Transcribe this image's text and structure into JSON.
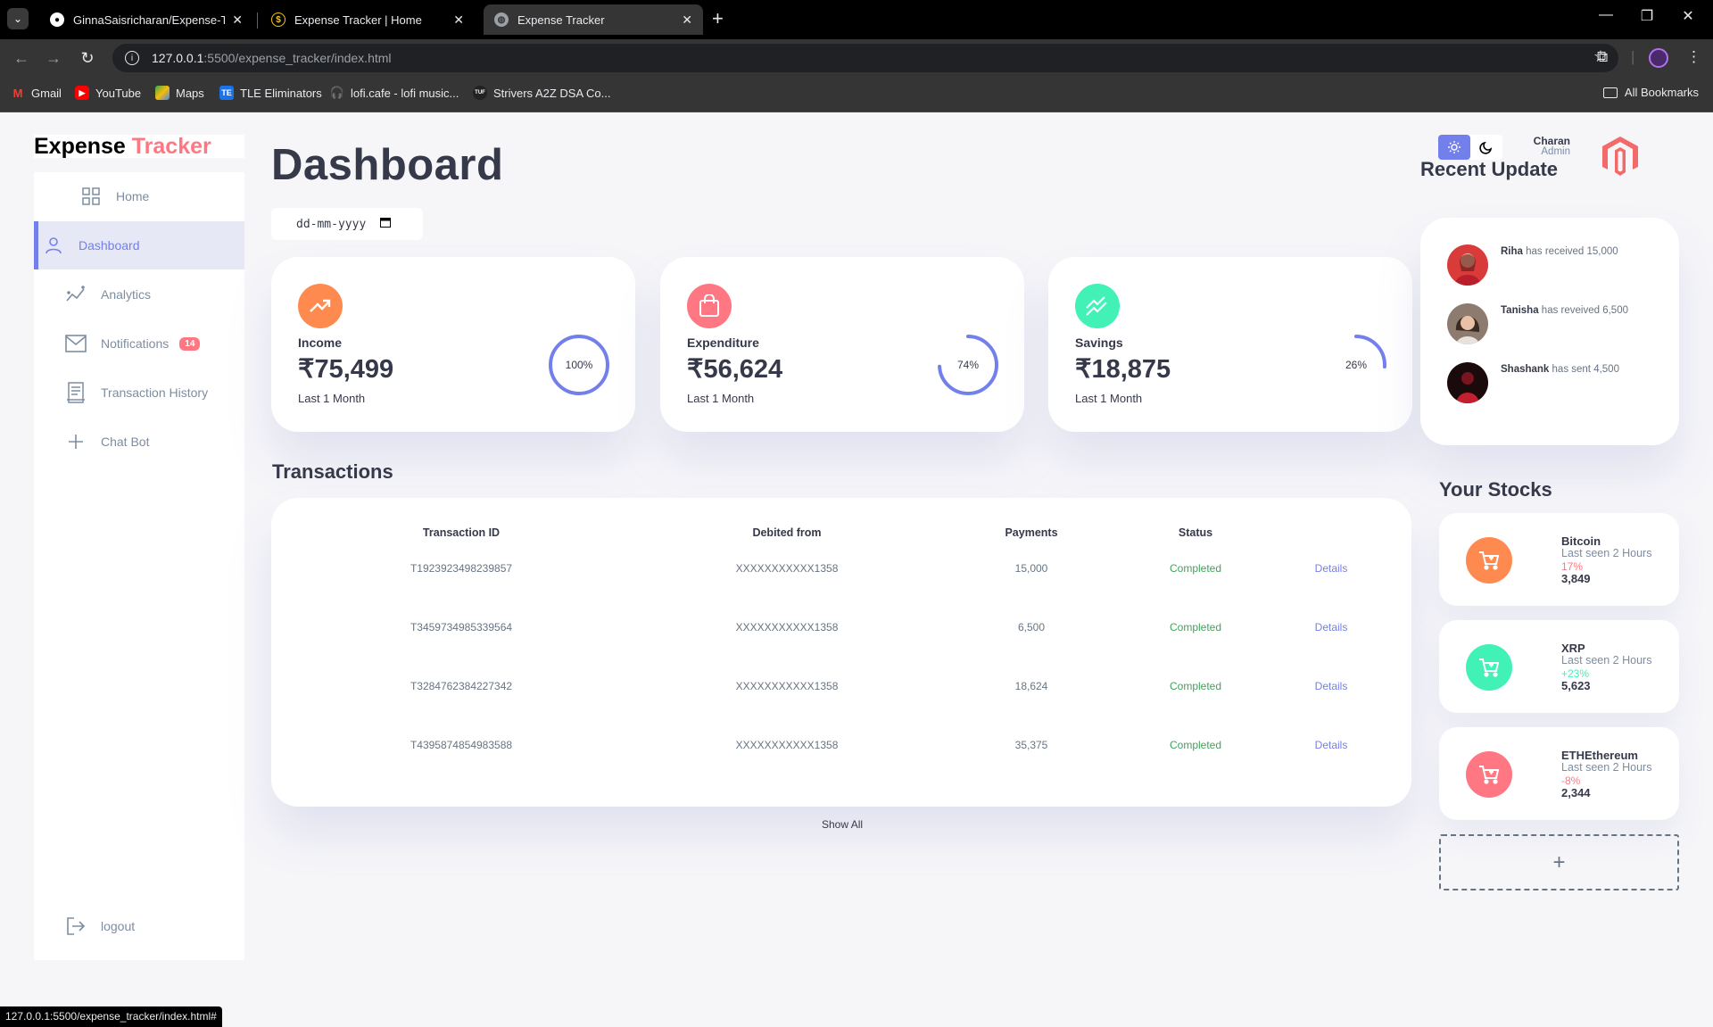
{
  "browser": {
    "tabs": [
      {
        "title": "GinnaSaisricharan/Expense-Trac",
        "icon": "github-icon"
      },
      {
        "title": "Expense Tracker | Home",
        "icon": "coin-icon"
      },
      {
        "title": "Expense Tracker",
        "icon": "globe-icon"
      }
    ],
    "url_host": "127.0.0.1",
    "url_path": ":5500/expense_tracker/index.html",
    "bookmarks": [
      "Gmail",
      "YouTube",
      "Maps",
      "TLE Eliminators",
      "lofi.cafe - lofi music...",
      "Strivers A2Z DSA Co..."
    ],
    "all_bookmarks": "All Bookmarks",
    "status_url": "127.0.0.1:5500/expense_tracker/index.html#"
  },
  "app": {
    "logo_main": "Expense ",
    "logo_accent": "Tracker",
    "sidebar": [
      {
        "label": "Home",
        "icon": "grid-icon"
      },
      {
        "label": "Dashboard",
        "icon": "person-icon",
        "active": true
      },
      {
        "label": "Analytics",
        "icon": "insights-icon"
      },
      {
        "label": "Notifications",
        "icon": "mail-icon",
        "badge": "14"
      },
      {
        "label": "Transaction History",
        "icon": "receipt-icon"
      },
      {
        "label": "Chat Bot",
        "icon": "plus-icon"
      }
    ],
    "logout": "logout",
    "title": "Dashboard",
    "date_placeholder": "dd-mm-yyyy",
    "cards": [
      {
        "label": "Income",
        "amount": "₹75,499",
        "sub": "Last 1 Month",
        "percent": "100%",
        "fraction": 1.0,
        "color": "#ff8a50"
      },
      {
        "label": "Expenditure",
        "amount": "₹56,624",
        "sub": "Last 1 Month",
        "percent": "74%",
        "fraction": 0.74,
        "color": "#ff7782"
      },
      {
        "label": "Savings",
        "amount": "₹18,875",
        "sub": "Last 1 Month",
        "percent": "26%",
        "fraction": 0.26,
        "color": "#41f1b6"
      }
    ],
    "transactions_title": "Transactions",
    "tx_headers": [
      "Transaction ID",
      "Debited from",
      "Payments",
      "Status"
    ],
    "transactions": [
      {
        "id": "T1923923498239857",
        "from": "XXXXXXXXXXX1358",
        "amount": "15,000",
        "status": "Completed",
        "link": "Details"
      },
      {
        "id": "T3459734985339564",
        "from": "XXXXXXXXXXX1358",
        "amount": "6,500",
        "status": "Completed",
        "link": "Details"
      },
      {
        "id": "T3284762384227342",
        "from": "XXXXXXXXXXX1358",
        "amount": "18,624",
        "status": "Completed",
        "link": "Details"
      },
      {
        "id": "T4395874854983588",
        "from": "XXXXXXXXXXX1358",
        "amount": "35,375",
        "status": "Completed",
        "link": "Details"
      }
    ],
    "show_all": "Show All",
    "user": {
      "name": "Charan",
      "role": "Admin"
    },
    "recent_title": "Recent Update",
    "updates": [
      {
        "name": "Riha",
        "text": " has received 15,000",
        "color": "#d93a3a"
      },
      {
        "name": "Tanisha",
        "text": " has reveived 6,500",
        "color": "#6b5a55"
      },
      {
        "name": "Shashank",
        "text": " has sent 4,500",
        "color": "#3a0f14"
      }
    ],
    "stocks_title": "Your Stocks",
    "stocks": [
      {
        "name": "Bitcoin",
        "seen": "Last seen 2 Hours",
        "change": "17%",
        "value": "3,849",
        "color": "#ff8a50",
        "change_color": "#ff7782"
      },
      {
        "name": "XRP",
        "seen": "Last seen 2 Hours",
        "change": "+23%",
        "value": "5,623",
        "color": "#41f1b6",
        "change_color": "#41f1b6"
      },
      {
        "name": "ETHEthereum",
        "seen": "Last seen 2 Hours",
        "change": "-8%",
        "value": "2,344",
        "color": "#ff7782",
        "change_color": "#ff7782"
      }
    ],
    "accent": "#7380ec"
  }
}
